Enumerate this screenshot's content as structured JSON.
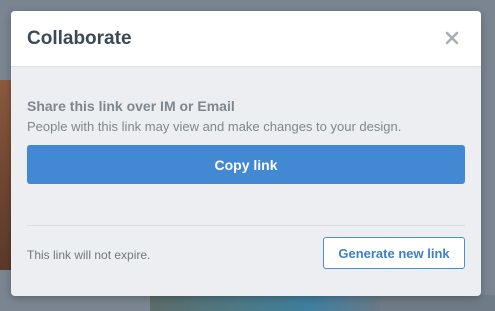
{
  "dialog": {
    "title": "Collaborate",
    "close_icon": "close-icon"
  },
  "share": {
    "heading": "Share this link over IM or Email",
    "description": "People with this link may view and make changes to your design.",
    "copy_button_label": "Copy link"
  },
  "footer": {
    "expire_text": "This link will not expire.",
    "generate_button_label": "Generate new link"
  },
  "colors": {
    "primary": "#4388d3",
    "dialog_background": "#eceef1",
    "header_background": "#ffffff",
    "title_text": "#3b4a55",
    "muted_text": "#7e8790"
  }
}
